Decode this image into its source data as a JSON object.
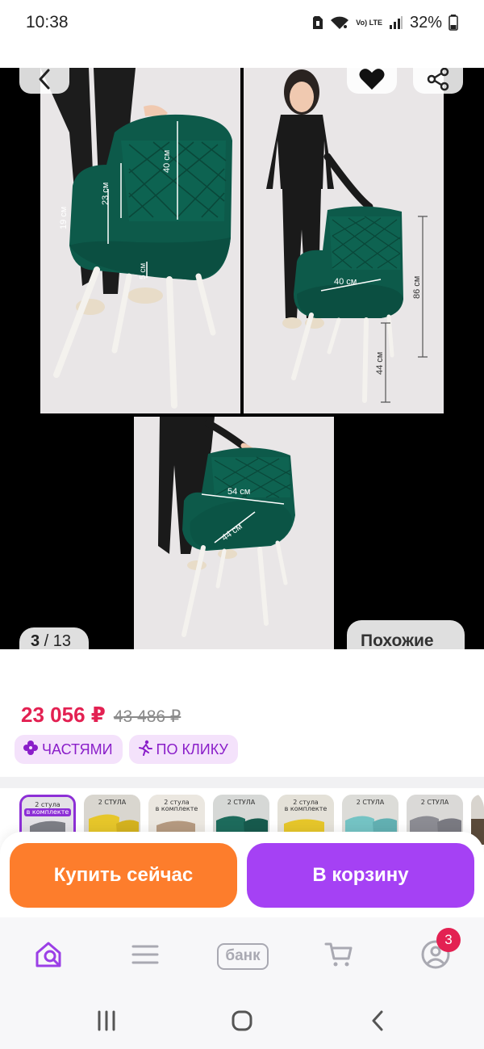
{
  "status_bar": {
    "time": "10:38",
    "network": "Vo) LTE",
    "battery": "32%"
  },
  "gallery": {
    "counter_current": "3",
    "counter_total": " / 13",
    "similar_label": "Похожие",
    "photo_1": {
      "dim_back": "40 см",
      "dim_arm_back": "23 см",
      "dim_arm": "19 см",
      "dim_seat": "5 см"
    },
    "photo_2": {
      "dim_seat_width": "40 см",
      "dim_height": "86 см",
      "dim_leg": "44 см"
    },
    "photo_3": {
      "dim_width": "54 см",
      "dim_depth": "44 см"
    }
  },
  "price": {
    "current": "23 056 ₽",
    "old": "43 486 ₽"
  },
  "badges": [
    {
      "label": "ЧАСТЯМИ",
      "icon": "flower-icon"
    },
    {
      "label": "ПО КЛИКУ",
      "icon": "running-person-icon"
    }
  ],
  "thumbnails": [
    {
      "caption_top": "2 стула",
      "caption_bottom": "в комплекте",
      "color": "#7d7e86",
      "active": true
    },
    {
      "caption_top": "2 СТУЛА",
      "caption_bottom": "",
      "color": "#e6c62a"
    },
    {
      "caption_top": "2 стула",
      "caption_bottom": "в комплекте",
      "color": "#b59a80"
    },
    {
      "caption_top": "2 СТУЛА",
      "caption_bottom": "",
      "color": "#1d6b5c"
    },
    {
      "caption_top": "2 стула",
      "caption_bottom": "в комплекте",
      "color": "#e6c62a"
    },
    {
      "caption_top": "2 СТУЛА",
      "caption_bottom": "",
      "color": "#74c3c4"
    },
    {
      "caption_top": "2 СТУЛА",
      "caption_bottom": "",
      "color": "#8c8c93"
    },
    {
      "caption_top": "",
      "caption_bottom": "",
      "color": "#5a4a3a"
    }
  ],
  "actions": {
    "buy_now": "Купить сейчас",
    "add_to_cart": "В корзину"
  },
  "tab_bar": {
    "bank_label": "банк",
    "profile_badge": "3"
  },
  "colors": {
    "price_red": "#e32152",
    "buy_orange": "#fd7d2c",
    "cart_purple": "#a541f4",
    "badge_text": "#8a1ec9",
    "badge_bg": "#f4e2fb",
    "chair_green": "#0d5a4a"
  }
}
